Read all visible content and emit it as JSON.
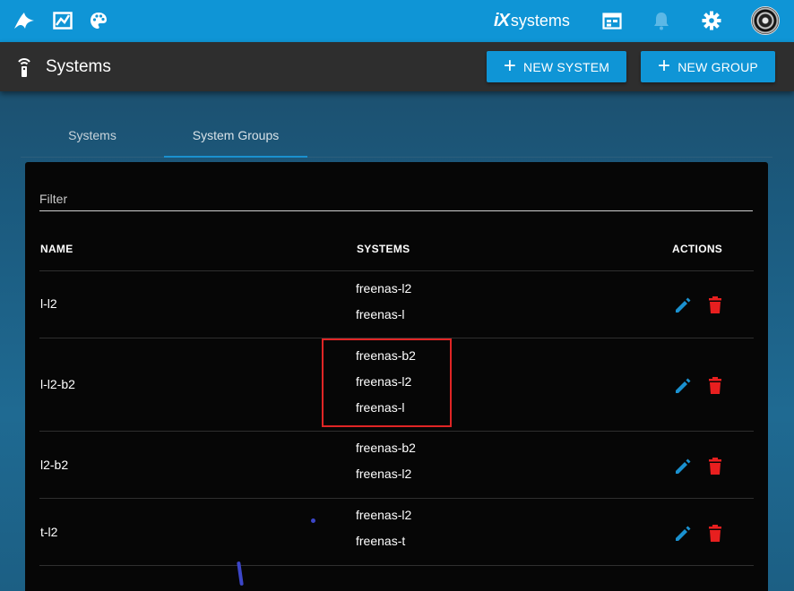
{
  "app": {
    "brand_mark": "iX",
    "brand_text": "systems"
  },
  "topbar": {
    "icons": [
      "freenas-logo-icon",
      "reports-icon",
      "theme-palette-icon",
      "calendar-icon",
      "notifications-bell-icon",
      "settings-gear-icon"
    ]
  },
  "page": {
    "title": "Systems",
    "new_system_label": "NEW SYSTEM",
    "new_group_label": "NEW GROUP"
  },
  "tabs": [
    {
      "label": "Systems",
      "active": false
    },
    {
      "label": "System Groups",
      "active": true
    }
  ],
  "filter": {
    "label": "Filter"
  },
  "table": {
    "headers": {
      "name": "NAME",
      "systems": "SYSTEMS",
      "actions": "ACTIONS"
    },
    "rows": [
      {
        "name": "l-l2",
        "systems": [
          "freenas-l2",
          "freenas-l"
        ]
      },
      {
        "name": "l-l2-b2",
        "systems": [
          "freenas-b2",
          "freenas-l2",
          "freenas-l"
        ]
      },
      {
        "name": "l2-b2",
        "systems": [
          "freenas-b2",
          "freenas-l2"
        ]
      },
      {
        "name": "t-l2",
        "systems": [
          "freenas-l2",
          "freenas-t"
        ]
      }
    ]
  },
  "colors": {
    "accent": "#0f95d6",
    "header_bar": "#2e2e2e",
    "card_bg": "#060606",
    "delete": "#e81f1f",
    "edit": "#1a91d0",
    "highlight_box": "#e02525"
  }
}
